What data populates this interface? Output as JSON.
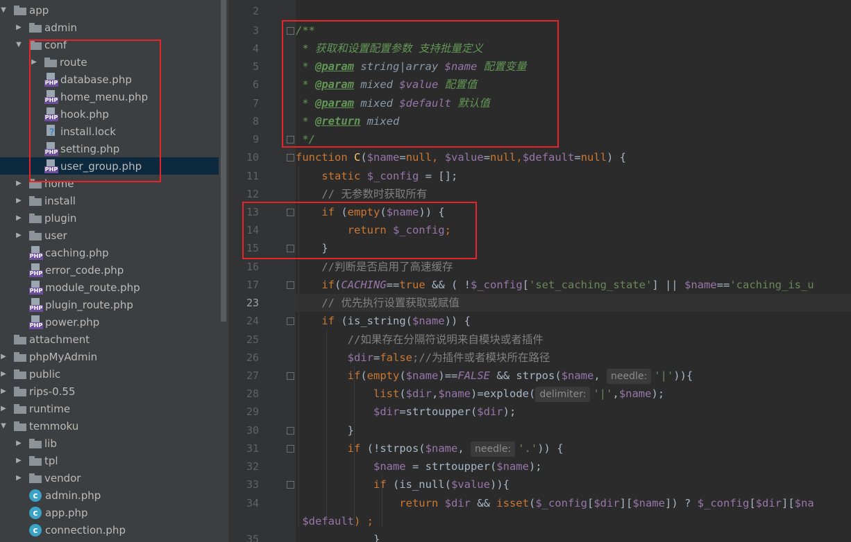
{
  "project_tree": {
    "items": [
      {
        "label": "app",
        "type": "folder",
        "arrow": "expanded",
        "depth": 0
      },
      {
        "label": "admin",
        "type": "folder",
        "arrow": "collapsed",
        "depth": 1
      },
      {
        "label": "conf",
        "type": "folder",
        "arrow": "expanded",
        "depth": 1
      },
      {
        "label": "route",
        "type": "folder",
        "arrow": "collapsed",
        "depth": 2
      },
      {
        "label": "database.php",
        "type": "php",
        "depth": 2
      },
      {
        "label": "home_menu.php",
        "type": "php",
        "depth": 2
      },
      {
        "label": "hook.php",
        "type": "php",
        "depth": 2
      },
      {
        "label": "install.lock",
        "type": "lock",
        "depth": 2
      },
      {
        "label": "setting.php",
        "type": "php",
        "depth": 2
      },
      {
        "label": "user_group.php",
        "type": "php",
        "depth": 2,
        "selected": true
      },
      {
        "label": "home",
        "type": "folder",
        "arrow": "collapsed",
        "depth": 1
      },
      {
        "label": "install",
        "type": "folder",
        "arrow": "collapsed",
        "depth": 1
      },
      {
        "label": "plugin",
        "type": "folder",
        "arrow": "collapsed",
        "depth": 1
      },
      {
        "label": "user",
        "type": "folder",
        "arrow": "collapsed",
        "depth": 1
      },
      {
        "label": "caching.php",
        "type": "php",
        "depth": 1
      },
      {
        "label": "error_code.php",
        "type": "php",
        "depth": 1
      },
      {
        "label": "module_route.php",
        "type": "php",
        "depth": 1
      },
      {
        "label": "plugin_route.php",
        "type": "php",
        "depth": 1
      },
      {
        "label": "power.php",
        "type": "php",
        "depth": 1
      },
      {
        "label": "attachment",
        "type": "folder",
        "depth": 0
      },
      {
        "label": "phpMyAdmin",
        "type": "folder",
        "arrow": "collapsed",
        "depth": 0
      },
      {
        "label": "public",
        "type": "folder",
        "arrow": "collapsed",
        "depth": 0
      },
      {
        "label": "rips-0.55",
        "type": "folder",
        "arrow": "collapsed",
        "depth": 0
      },
      {
        "label": "runtime",
        "type": "folder",
        "arrow": "collapsed",
        "depth": 0
      },
      {
        "label": "temmoku",
        "type": "folder",
        "arrow": "expanded",
        "depth": 0
      },
      {
        "label": "lib",
        "type": "folder",
        "arrow": "collapsed",
        "depth": 1
      },
      {
        "label": "tpl",
        "type": "folder",
        "arrow": "collapsed",
        "depth": 1
      },
      {
        "label": "vendor",
        "type": "folder",
        "arrow": "collapsed",
        "depth": 1
      },
      {
        "label": "admin.php",
        "type": "class",
        "depth": 1
      },
      {
        "label": "app.php",
        "type": "class",
        "depth": 1
      },
      {
        "label": "connection.php",
        "type": "class",
        "depth": 1
      }
    ]
  },
  "editor": {
    "current_line": "23",
    "line_numbers": [
      "2",
      "3",
      "4",
      "5",
      "6",
      "7",
      "8",
      "9",
      "10",
      "11",
      "12",
      "13",
      "14",
      "15",
      "16",
      "17",
      "23",
      "24",
      "25",
      "26",
      "27",
      "28",
      "29",
      "30",
      "31",
      "32",
      "33",
      "34",
      "",
      "35"
    ],
    "code": {
      "l3": "/**",
      "l4_star": " * ",
      "l4_text": "获取和设置配置参数 支持批量定义",
      "l5_star": " * ",
      "l5_tag": "@param",
      "l5_type": " string|array ",
      "l5_var": "$name",
      "l5_desc": " 配置变量",
      "l6_star": " * ",
      "l6_tag": "@param",
      "l6_type": " mixed ",
      "l6_var": "$value",
      "l6_desc": " 配置值",
      "l7_star": " * ",
      "l7_tag": "@param",
      "l7_type": " mixed ",
      "l7_var": "$default",
      "l7_desc": " 默认值",
      "l8_star": " * ",
      "l8_tag": "@return",
      "l8_type": " mixed",
      "l9": " */",
      "l10_kw": "function",
      "l10_fn": " C",
      "l10_p1": "(",
      "l10_v1": "$name",
      "l10_e1": "=",
      "l10_n1": "null",
      "l10_c1": ", ",
      "l10_v2": "$value",
      "l10_e2": "=",
      "l10_n2": "null",
      "l10_c2": ",",
      "l10_v3": "$default",
      "l10_e3": "=",
      "l10_n3": "null",
      "l10_end": ") {",
      "l11_kw": "    static ",
      "l11_var": "$_config",
      "l11_rest": " = [];",
      "l12": "    // 无参数时获取所有",
      "l13_kw": "    if ",
      "l13_p": "(",
      "l13_fn": "empty",
      "l13_p2": "(",
      "l13_var": "$name",
      "l13_end": ")) {",
      "l14_kw": "        return ",
      "l14_var": "$_config",
      "l14_end": ";",
      "l15": "    }",
      "l16": "    //判断是否启用了高速缓存",
      "l17_kw": "    if",
      "l17_p": "(",
      "l17_cst": "CACHING",
      "l17_eq": "==",
      "l17_true": "true",
      "l17_and": " && ( !",
      "l17_var": "$_config",
      "l17_b": "[",
      "l17_str": "'set_caching_state'",
      "l17_b2": "] || ",
      "l17_var2": "$name",
      "l17_eq2": "==",
      "l17_str2": "'caching_is_u",
      "l23": "    // 优先执行设置获取或赋值",
      "l24_kw": "    if ",
      "l24_p": "(is_string(",
      "l24_var": "$name",
      "l24_end": ")) {",
      "l25": "        //如果存在分隔符说明来自模块或者插件",
      "l26_var": "        $dir",
      "l26_eq": "=",
      "l26_false": "false",
      "l26_cm": ";//为插件或者模块所在路径",
      "l27_kw": "        if",
      "l27_p": "(",
      "l27_fn": "empty",
      "l27_p2": "(",
      "l27_var": "$name",
      "l27_eq": ")==",
      "l27_cst": "FALSE",
      "l27_and": " && strpos(",
      "l27_var2": "$name",
      "l27_c": ", ",
      "l27_hint": "needle:",
      "l27_str": "'|'",
      "l27_end": ")){",
      "l28_fn": "            list",
      "l28_p": "(",
      "l28_var": "$dir",
      "l28_c": ",",
      "l28_var2": "$name",
      "l28_eq": ")=explode(",
      "l28_hint": "delimiter:",
      "l28_str": "'|'",
      "l28_c2": ",",
      "l28_var3": "$name",
      "l28_end": ");",
      "l29_var": "            $dir",
      "l29_eq": "=strtoupper(",
      "l29_var2": "$dir",
      "l29_end": ");",
      "l30": "        }",
      "l31_kw": "        if ",
      "l31_p": "(!strpos(",
      "l31_var": "$name",
      "l31_c": ", ",
      "l31_hint": "needle:",
      "l31_str": "'.'",
      "l31_end": ")) {",
      "l32_var": "            $name",
      "l32_eq": " = strtoupper(",
      "l32_var2": "$name",
      "l32_end": ");",
      "l33_kw": "            if ",
      "l33_p": "(is_null(",
      "l33_var": "$value",
      "l33_end": ")){",
      "l34_kw": "                return ",
      "l34_var": "$dir",
      "l34_and": " && ",
      "l34_fn": "isset",
      "l34_p": "(",
      "l34_var2": "$_config",
      "l34_b": "[",
      "l34_var3": "$dir",
      "l34_b2": "][",
      "l34_var4": "$name",
      "l34_b3": "]) ? ",
      "l34_var5": "$_config",
      "l34_b4": "[",
      "l34_var6": "$dir",
      "l34_b5": "][",
      "l34_var7": "$na",
      "l34b_var": " $default",
      "l34b_end": ") ;",
      "l35": "            }"
    }
  },
  "colors": {
    "highlight_box": "#e5252a",
    "sidebar_bg": "#3c3f41",
    "editor_bg": "#2b2b2b",
    "selection": "#0d293e"
  }
}
